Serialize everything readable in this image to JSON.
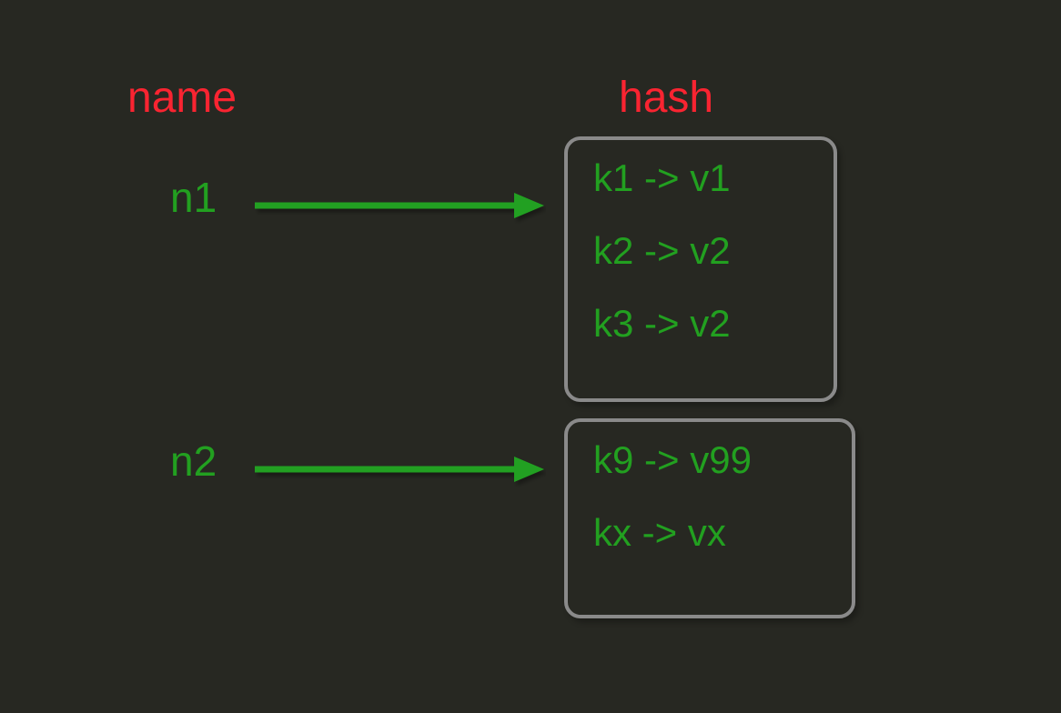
{
  "headers": {
    "name": "name",
    "hash": "hash"
  },
  "names": {
    "n1": "n1",
    "n2": "n2"
  },
  "boxes": {
    "box1": {
      "entry1": "k1 -> v1",
      "entry2": "k2 -> v2",
      "entry3": "k3 -> v2"
    },
    "box2": {
      "entry1": "k9 -> v99",
      "entry2": "kx -> vx"
    }
  },
  "colors": {
    "background": "#272822",
    "header_text": "#f92431",
    "value_text": "#22a020",
    "arrow": "#22a020",
    "box_border": "#8a8a8a"
  }
}
